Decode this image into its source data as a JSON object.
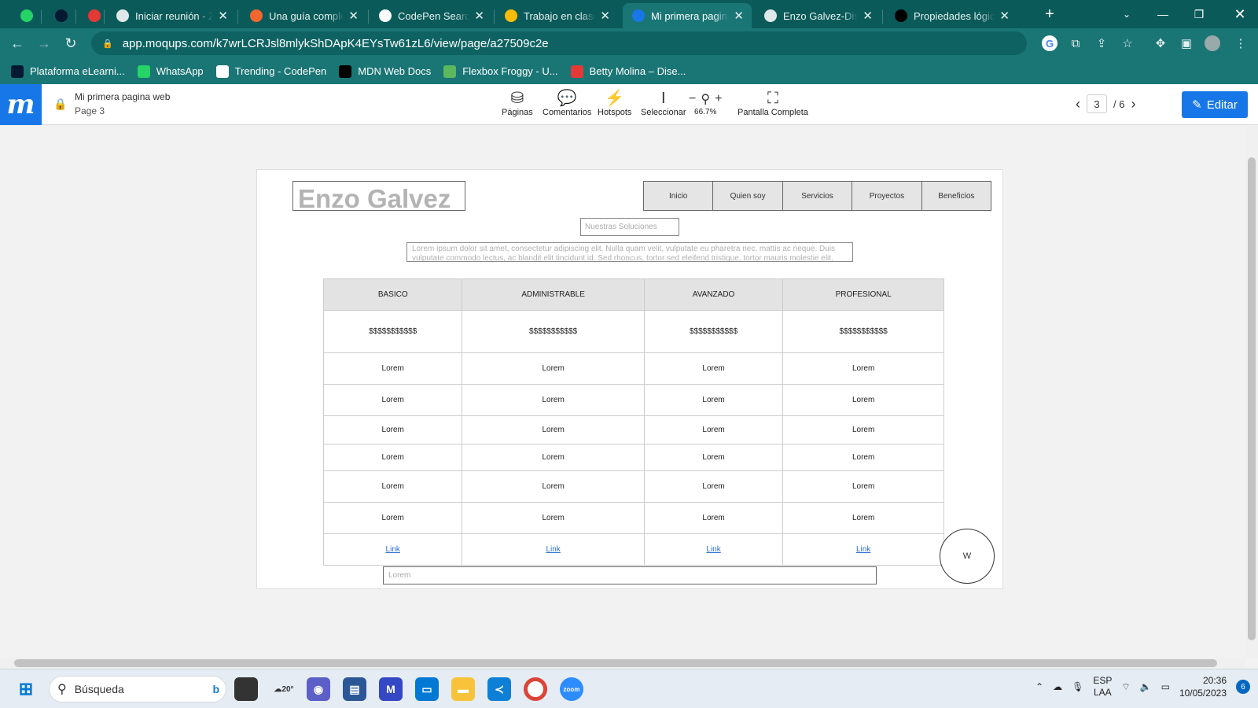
{
  "browser": {
    "tabs": [
      {
        "title": "",
        "icon": "whatsapp-icon",
        "color": "#25d366"
      },
      {
        "title": "",
        "icon": "alura-icon",
        "color": "#051933"
      },
      {
        "title": "",
        "icon": "record-icon",
        "color": "#e53935"
      },
      {
        "title": "Iniciar reunión - Zoom",
        "icon": "globe-icon",
        "color": "#dfe8e8"
      },
      {
        "title": "Una guía completa",
        "icon": "asterisk-icon",
        "color": "#f1672e"
      },
      {
        "title": "CodePen Search",
        "icon": "codepen-icon",
        "color": "#ffffff"
      },
      {
        "title": "Trabajo en clase - Google Drive",
        "icon": "drive-icon",
        "color": "#fbbc04"
      },
      {
        "title": "Mi primera pagina web",
        "icon": "moqups-icon",
        "color": "#1877e8",
        "active": true
      },
      {
        "title": "Enzo Galvez-Diseño",
        "icon": "globe-icon",
        "color": "#dfe8e8"
      },
      {
        "title": "Propiedades lógicas",
        "icon": "mdn-icon",
        "color": "#000000"
      }
    ],
    "url": "app.moqups.com/k7wrLCRJsl8mlykShDApK4EYsTw61zL6/view/page/a27509c2e",
    "bookmarks": [
      {
        "label": "Plataforma eLearni...",
        "icon": "alura-icon"
      },
      {
        "label": "WhatsApp",
        "icon": "whatsapp-icon"
      },
      {
        "label": "Trending - CodePen",
        "icon": "codepen-icon"
      },
      {
        "label": "MDN Web Docs",
        "icon": "mdn-icon"
      },
      {
        "label": "Flexbox Froggy - U...",
        "icon": "frog-icon"
      },
      {
        "label": "Betty Molina – Dise...",
        "icon": "record-icon"
      }
    ]
  },
  "moqups": {
    "project": "Mi primera pagina web",
    "page": "Page 3",
    "tools": {
      "pages": "Páginas",
      "comments": "Comentarios",
      "hotspots": "Hotspots",
      "select": "Seleccionar",
      "fullscreen": "Pantalla Completa"
    },
    "zoom": "66.7%",
    "current_page": "3",
    "total_pages": "/ 6",
    "edit": "Editar",
    "accent": "#1877e8"
  },
  "mockup": {
    "brand": "Enzo Galvez",
    "nav": [
      "Inicio",
      "Quien soy",
      "Servicios",
      "Proyectos",
      "Beneficios"
    ],
    "subtitle_placeholder": "Nuestras Soluciones",
    "paragraph": "Lorem ipsum dolor sit amet, consectetur adipiscing elit. Nulla quam velit, vulputate eu pharetra nec, mattis ac neque. Duis vulputate commodo lectus, ac blandit elit tincidunt id. Sed rhoncus, tortor sed eleifend tristique, tortor mauris molestie elit.",
    "columns": [
      "BASICO",
      "ADMINISTRABLE",
      "AVANZADO",
      "PROFESIONAL"
    ],
    "prices": [
      "$$$$$$$$$$$",
      "$$$$$$$$$$$",
      "$$$$$$$$$$$",
      "$$$$$$$$$$$"
    ],
    "rows": [
      [
        "Lorem",
        "Lorem",
        "Lorem",
        "Lorem"
      ],
      [
        "Lorem",
        "Lorem",
        "Lorem",
        "Lorem"
      ],
      [
        "Lorem",
        "Lorem",
        "Lorem",
        "Lorem"
      ],
      [
        "Lorem",
        "Lorem",
        "Lorem",
        "Lorem"
      ],
      [
        "Lorem",
        "Lorem",
        "Lorem",
        "Lorem"
      ],
      [
        "Lorem",
        "Lorem",
        "Lorem",
        "Lorem"
      ]
    ],
    "links": [
      "Link",
      "Link",
      "Link",
      "Link"
    ],
    "circle_label": "W",
    "footer_placeholder": "Lorem"
  },
  "taskbar": {
    "search": "Búsqueda",
    "weather": "20°",
    "lang_top": "ESP",
    "lang_bottom": "LAA",
    "time": "20:36",
    "date": "10/05/2023",
    "notifications": "6"
  }
}
